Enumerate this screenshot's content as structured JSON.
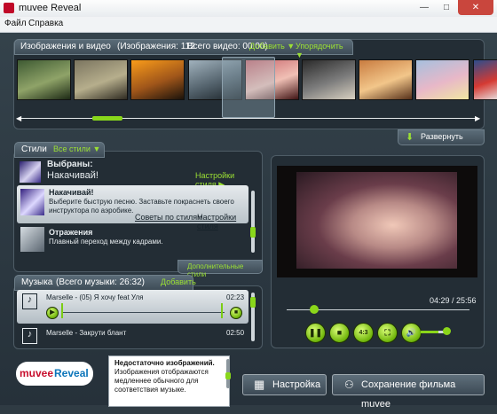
{
  "window": {
    "title": "muvee Reveal",
    "min": "—",
    "max": "□",
    "close": "✕"
  },
  "menu": {
    "items": [
      "Файл",
      "Справка"
    ]
  },
  "media": {
    "title": "Изображения и видео",
    "images": "(Изображения: 112",
    "videos": "Всего видео: 00:00)",
    "add": "Добавить ▼",
    "arrange": "Упорядочить ▼",
    "expand": "Развернуть",
    "thumbs": [
      {
        "name": "green-scene",
        "colors": [
          "#3e5a33",
          "#8fa368",
          "#1d2a16"
        ]
      },
      {
        "name": "city-church",
        "colors": [
          "#7b7560",
          "#b6ae8c",
          "#2f2b22"
        ]
      },
      {
        "name": "sunset",
        "colors": [
          "#fa9c1a",
          "#a0561a",
          "#1b130b"
        ]
      },
      {
        "name": "bridge",
        "colors": [
          "#a1b2bd",
          "#54636d",
          "#1a2227"
        ]
      },
      {
        "name": "pink-fabric",
        "colors": [
          "#c8646a",
          "#f0c0b5",
          "#401414"
        ]
      },
      {
        "name": "stop-sign",
        "colors": [
          "#2b2b2b",
          "#7d7d7d",
          "#d8d0c0"
        ]
      },
      {
        "name": "cat",
        "colors": [
          "#c97c40",
          "#f2c68a",
          "#56301a"
        ]
      },
      {
        "name": "pastel-candles",
        "colors": [
          "#a6c0de",
          "#e8b8c8",
          "#f0e6a2"
        ]
      },
      {
        "name": "red-toy",
        "colors": [
          "#2c4d8c",
          "#d53a33",
          "#e7e7e7"
        ]
      }
    ]
  },
  "styles": {
    "title": "Стили",
    "all": "Все стили ▼",
    "selected_label": "Выбраны:",
    "selected_value": "Накачивай!",
    "settings_link": "Настройки стиля ▶",
    "items": [
      {
        "name": "Накачивай!",
        "desc": "Выберите быструю песню. Заставьте покраснеть своего инструктора по аэробике.",
        "link1": "Советы по стилям",
        "link2": "Настройки стиля"
      },
      {
        "name": "Отражения",
        "desc": "Плавный переход между кадрами."
      }
    ],
    "extra": "Дополнительные стили"
  },
  "music": {
    "title": "Музыка",
    "total": "(Всего музыки: 26:32)",
    "add": "Добавить",
    "tracks": [
      {
        "title": "Marselle - (05) Я хочу feat Уля",
        "time": "02:23"
      },
      {
        "title": "Marselle - Закрути блант",
        "time": "02:50"
      }
    ]
  },
  "preview": {
    "time": "04:29 / 25:56",
    "progress": 0.15,
    "volume": 0.7,
    "aspect": "4:3"
  },
  "status": {
    "brand1": "muvee",
    "brand2": "Reveal",
    "warn_title": "Недостаточно изображений.",
    "warn_text": "Изображения отображаются медленнее обычного для соответствия музыке."
  },
  "buttons": {
    "settings": "Настройка",
    "save": "Сохранение фильма muvee"
  }
}
